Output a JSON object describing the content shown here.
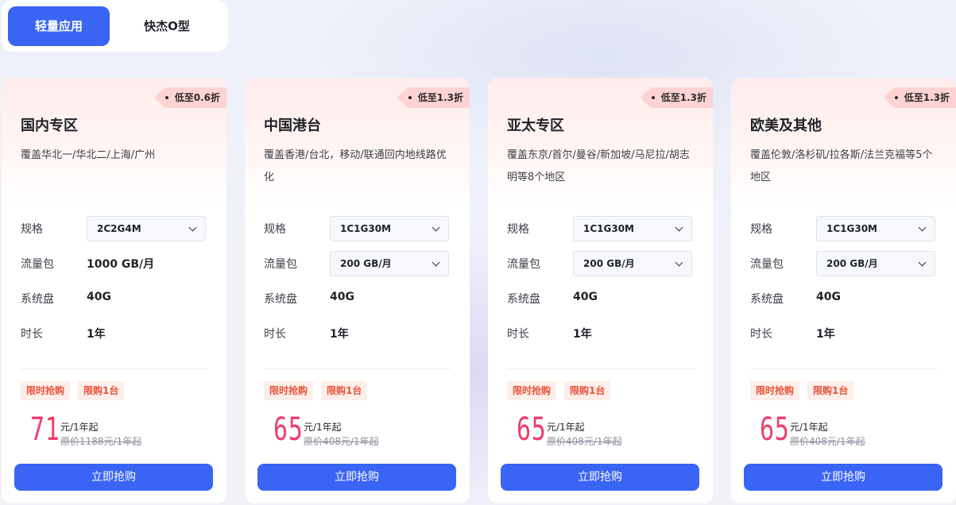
{
  "tabs": [
    {
      "label": "轻量应用",
      "active": true
    },
    {
      "label": "快杰O型",
      "active": false
    }
  ],
  "labels": {
    "spec": "规格",
    "traffic": "流量包",
    "disk": "系统盘",
    "duration": "时长",
    "tag_flash": "限时抢购",
    "tag_limit": "限购1台",
    "per_unit": "元/1年起",
    "buy_button": "立即抢购"
  },
  "cards": [
    {
      "badge": "低至0.6折",
      "title": "国内专区",
      "desc": "覆盖华北一/华北二/上海/广州",
      "spec": "2C2G4M",
      "traffic": "1000 GB/月",
      "traffic_is_select": false,
      "disk": "40G",
      "duration": "1年",
      "price": "71",
      "original": "原价1188元/1年起"
    },
    {
      "badge": "低至1.3折",
      "title": "中国港台",
      "desc": "覆盖香港/台北，移动/联通回内地线路优化",
      "spec": "1C1G30M",
      "traffic": "200 GB/月",
      "traffic_is_select": true,
      "disk": "40G",
      "duration": "1年",
      "price": "65",
      "original": "原价408元/1年起"
    },
    {
      "badge": "低至1.3折",
      "title": "亚太专区",
      "desc": "覆盖东京/首尔/曼谷/新加坡/马尼拉/胡志明等8个地区",
      "spec": "1C1G30M",
      "traffic": "200 GB/月",
      "traffic_is_select": true,
      "disk": "40G",
      "duration": "1年",
      "price": "65",
      "original": "原价408元/1年起"
    },
    {
      "badge": "低至1.3折",
      "title": "欧美及其他",
      "desc": "覆盖伦敦/洛杉矶/拉各斯/法兰克福等5个地区",
      "spec": "1C1G30M",
      "traffic": "200 GB/月",
      "traffic_is_select": true,
      "disk": "40G",
      "duration": "1年",
      "price": "65",
      "original": "原价408元/1年起"
    }
  ],
  "colors": {
    "accent": "#3a64f4",
    "price": "#f03d6c",
    "tag_text": "#e8533a",
    "tag_bg": "#fdeee9",
    "badge_bg": "#ffd3d3"
  }
}
